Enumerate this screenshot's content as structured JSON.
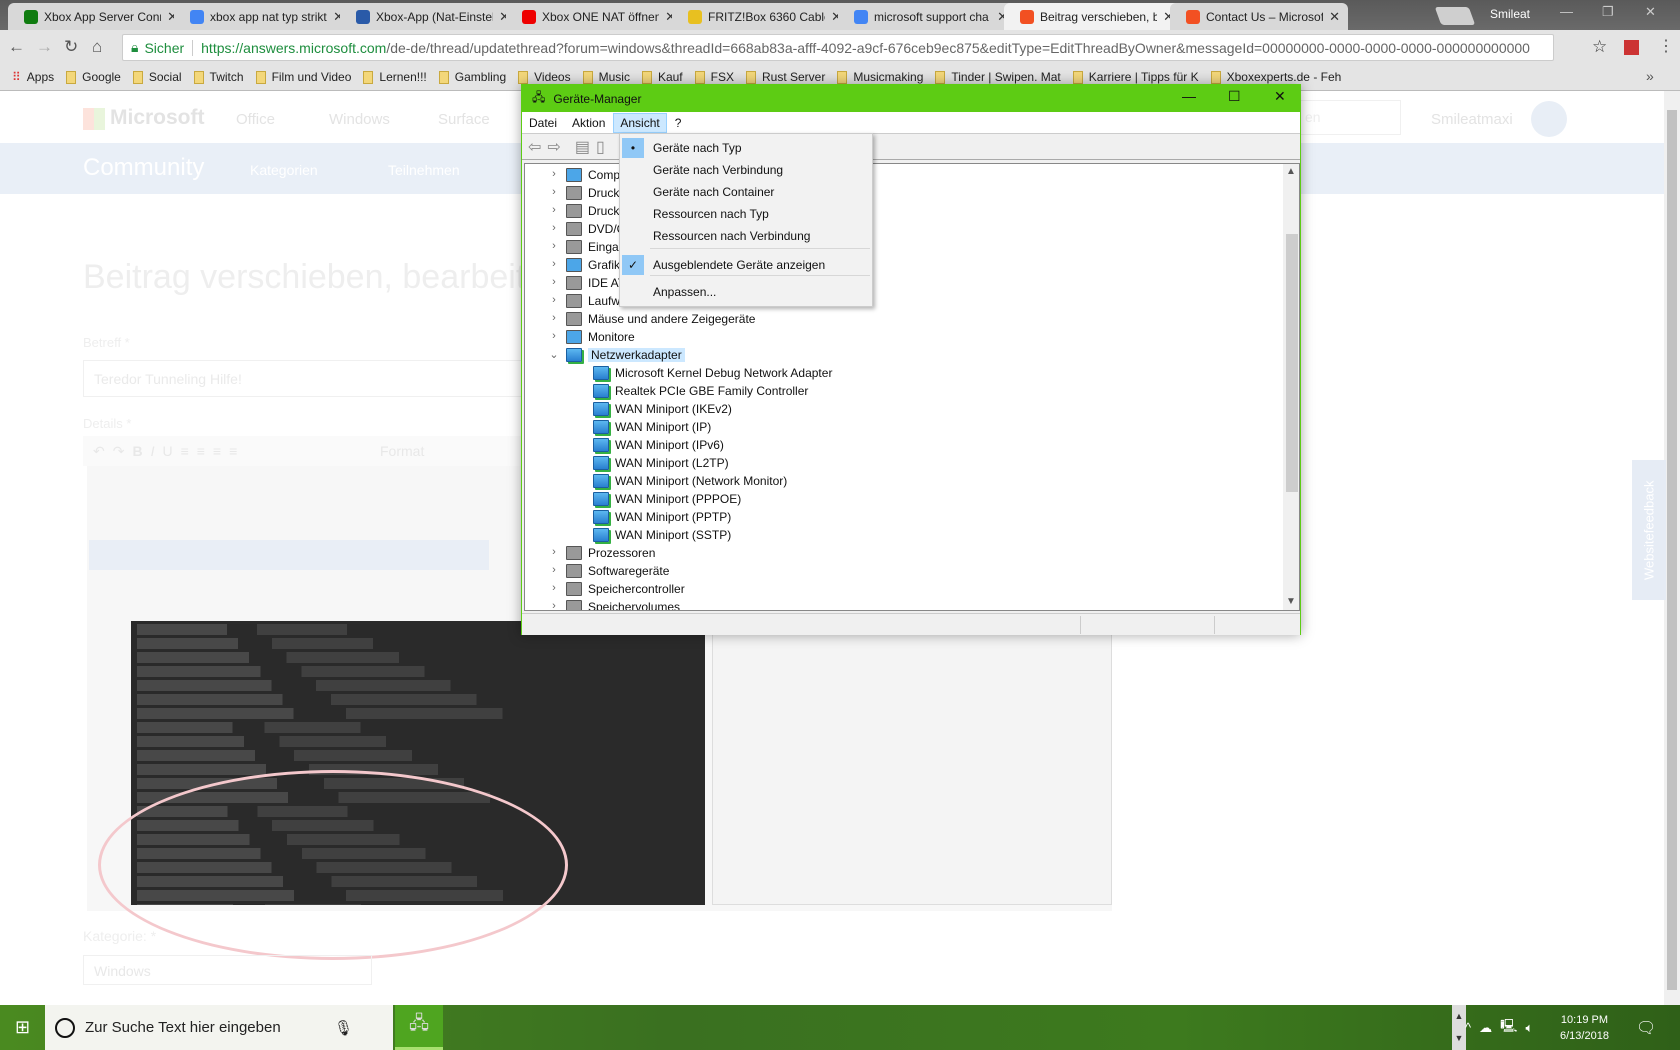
{
  "browser": {
    "tabs": [
      {
        "title": "Xbox App Server Conn",
        "icon": "xbox-icon",
        "color": "#107c10"
      },
      {
        "title": "xbox app nat typ strikt",
        "icon": "google-icon",
        "color": "#4285f4"
      },
      {
        "title": "Xbox-App (Nat-Einstel",
        "icon": "computerbase-icon",
        "color": "#2a5aa8"
      },
      {
        "title": "Xbox ONE NAT öffnen",
        "icon": "youtube-icon",
        "color": "#e00"
      },
      {
        "title": "FRITZ!Box 6360 Cable",
        "icon": "fritz-icon",
        "color": "#e8c020"
      },
      {
        "title": "microsoft support cha",
        "icon": "google-icon",
        "color": "#4285f4"
      },
      {
        "title": "Beitrag verschieben, b",
        "icon": "microsoft-icon",
        "color": "#f25022"
      },
      {
        "title": "Contact Us – Microsof",
        "icon": "microsoft-icon",
        "color": "#f25022"
      }
    ],
    "profile": "Smileat",
    "security_label": "Sicher",
    "url_host": "https://answers.microsoft.com",
    "url_path": "/de-de/thread/updatethread?forum=windows&threadId=668ab83a-afff-4092-a9cf-676ceb9ec875&editType=EditThreadByOwner&messageId=00000000-0000-0000-0000-000000000000",
    "bookmarks": [
      "Apps",
      "Google",
      "Social",
      "Twitch",
      "Film und Video",
      "Lernen!!!",
      "Gambling",
      "Videos",
      "Music",
      "Kauf",
      "FSX",
      "Rust Server",
      "Musicmaking",
      "Tinder | Swipen. Mat",
      "Karriere | Tipps für K",
      "Xboxexperts.de - Feh"
    ]
  },
  "page": {
    "brand": "Microsoft",
    "nav": [
      "Office",
      "Windows",
      "Surface"
    ],
    "search_placeholder": "en",
    "user": "Smileatmaxi",
    "community": "Community",
    "menus": [
      "Kategorien",
      "Teilnehmen"
    ],
    "title": "Beitrag verschieben, bearbeiten",
    "subject_label": "Betreff *",
    "subject_value": "Teredor Tunneling Hilfe!",
    "details_label": "Details *",
    "format_label": "Format",
    "category_label": "Kategorie: *",
    "category_value": "Windows",
    "feedback": "Websitefeedback"
  },
  "devmgr": {
    "title": "Geräte-Manager",
    "menu": [
      "Datei",
      "Aktion",
      "Ansicht",
      "?"
    ],
    "tree": [
      {
        "label": "Comp",
        "exp": "›",
        "icon": "computer"
      },
      {
        "label": "Druck",
        "exp": "›",
        "icon": "printer"
      },
      {
        "label": "Druck",
        "exp": "›",
        "icon": "printer"
      },
      {
        "label": "DVD/C",
        "exp": "›",
        "icon": "dvd"
      },
      {
        "label": "Eingab",
        "exp": "›",
        "icon": "keyboard"
      },
      {
        "label": "Grafik",
        "exp": "›",
        "icon": "display"
      },
      {
        "label": "IDE AT",
        "exp": "›",
        "icon": "ide"
      },
      {
        "label": "Laufw",
        "exp": "›",
        "icon": "drive"
      },
      {
        "label": "Mäuse und andere Zeigegeräte",
        "exp": "›",
        "icon": "mouse"
      },
      {
        "label": "Monitore",
        "exp": "›",
        "icon": "monitor"
      },
      {
        "label": "Netzwerkadapter",
        "exp": "⌄",
        "icon": "network",
        "selected": true
      },
      {
        "label": "Microsoft Kernel Debug Network Adapter",
        "child": true
      },
      {
        "label": "Realtek PCIe GBE Family Controller",
        "child": true
      },
      {
        "label": "WAN Miniport (IKEv2)",
        "child": true
      },
      {
        "label": "WAN Miniport (IP)",
        "child": true
      },
      {
        "label": "WAN Miniport (IPv6)",
        "child": true
      },
      {
        "label": "WAN Miniport (L2TP)",
        "child": true
      },
      {
        "label": "WAN Miniport (Network Monitor)",
        "child": true
      },
      {
        "label": "WAN Miniport (PPPOE)",
        "child": true
      },
      {
        "label": "WAN Miniport (PPTP)",
        "child": true
      },
      {
        "label": "WAN Miniport (SSTP)",
        "child": true
      },
      {
        "label": "Prozessoren",
        "exp": "›",
        "icon": "cpu"
      },
      {
        "label": "Softwaregeräte",
        "exp": "›",
        "icon": "software"
      },
      {
        "label": "Speichercontroller",
        "exp": "›",
        "icon": "storage"
      },
      {
        "label": "Speichervolumes",
        "exp": "›",
        "icon": "volume"
      }
    ],
    "view_menu": [
      {
        "label": "Geräte nach Typ",
        "mark": "•"
      },
      {
        "label": "Geräte nach Verbindung",
        "mark": ""
      },
      {
        "label": "Geräte nach Container",
        "mark": ""
      },
      {
        "label": "Ressourcen nach Typ",
        "mark": ""
      },
      {
        "label": "Ressourcen nach Verbindung",
        "mark": ""
      },
      {
        "label": "Ausgeblendete Geräte anzeigen",
        "mark": "✓",
        "sep_before": true
      },
      {
        "label": "Anpassen...",
        "mark": "",
        "sep_before": true
      }
    ],
    "accent": "#5dcc14"
  },
  "taskbar": {
    "search_placeholder": "Zur Suche Text hier eingeben",
    "time": "10:19 PM",
    "date": "6/13/2018"
  }
}
